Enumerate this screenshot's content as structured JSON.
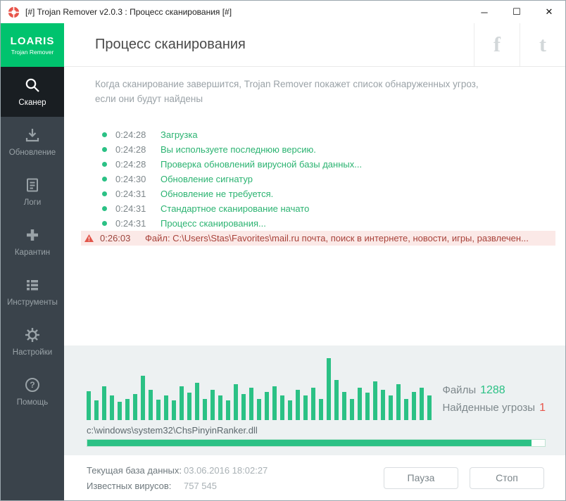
{
  "window": {
    "title": "[#] Trojan Remover v2.0.3 : Процесс сканирования [#]",
    "controls": {
      "minimize_glyph": "─",
      "maximize_glyph": "☐",
      "close_glyph": "✕"
    }
  },
  "brand": {
    "name": "LOARIS",
    "subtitle": "Trojan Remover"
  },
  "header": {
    "title": "Процесс сканирования",
    "social": {
      "facebook_glyph": "f",
      "twitter_glyph": "t"
    }
  },
  "sidebar": {
    "items": [
      {
        "label": "Сканер",
        "icon": "magnifier-icon",
        "active": true
      },
      {
        "label": "Обновление",
        "icon": "download-icon",
        "active": false
      },
      {
        "label": "Логи",
        "icon": "document-icon",
        "active": false
      },
      {
        "label": "Карантин",
        "icon": "plus-icon",
        "active": false
      },
      {
        "label": "Инструменты",
        "icon": "list-icon",
        "active": false
      },
      {
        "label": "Настройки",
        "icon": "gear-icon",
        "active": false
      },
      {
        "label": "Помощь",
        "icon": "question-icon",
        "active": false
      }
    ]
  },
  "scan": {
    "info": "Когда сканирование завершится, Trojan Remover покажет список обнаруженных угроз, если они будут найдены",
    "log": [
      {
        "time": "0:24:28",
        "message": "Загрузка",
        "type": "ok"
      },
      {
        "time": "0:24:28",
        "message": "Вы используете последнюю версию.",
        "type": "ok"
      },
      {
        "time": "0:24:28",
        "message": "Проверка обновлений вирусной базы данных...",
        "type": "ok"
      },
      {
        "time": "0:24:30",
        "message": "Обновление сигнатур",
        "type": "ok"
      },
      {
        "time": "0:24:31",
        "message": "Обновление не требуется.",
        "type": "ok"
      },
      {
        "time": "0:24:31",
        "message": "Стандартное сканирование начато",
        "type": "ok"
      },
      {
        "time": "0:24:31",
        "message": "Процесс сканирования...",
        "type": "ok"
      },
      {
        "time": "0:26:03",
        "message": "Файл: C:\\Users\\Stas\\Favorites\\mail.ru почта, поиск в интернете, новости, игры, развлечен...",
        "type": "alert"
      }
    ],
    "stats": {
      "files_label": "Файлы",
      "files_value": "1288",
      "threats_label": "Найденные угрозы",
      "threats_value": "1"
    },
    "current_file": "c:\\windows\\system32\\ChsPinyinRanker.dll",
    "progress_percent": 97,
    "activity_bars": [
      45,
      30,
      52,
      38,
      28,
      33,
      40,
      68,
      47,
      32,
      38,
      30,
      52,
      42,
      58,
      33,
      47,
      38,
      30,
      55,
      40,
      50,
      33,
      43,
      52,
      38,
      30,
      47,
      38,
      50,
      33,
      96,
      62,
      43,
      33,
      50,
      42,
      60,
      47,
      38,
      55,
      33,
      43,
      50,
      38
    ]
  },
  "footer": {
    "db_label": "Текущая база данных:",
    "db_value": "03.06.2016 18:02:27",
    "viruses_label": "Известных вирусов:",
    "viruses_value": "757 545",
    "pause_label": "Пауза",
    "stop_label": "Стоп"
  },
  "colors": {
    "brand_green": "#00c36e",
    "accent_green": "#2bc185",
    "alert_red": "#e8544a",
    "sidebar_dark": "#3a434b"
  }
}
